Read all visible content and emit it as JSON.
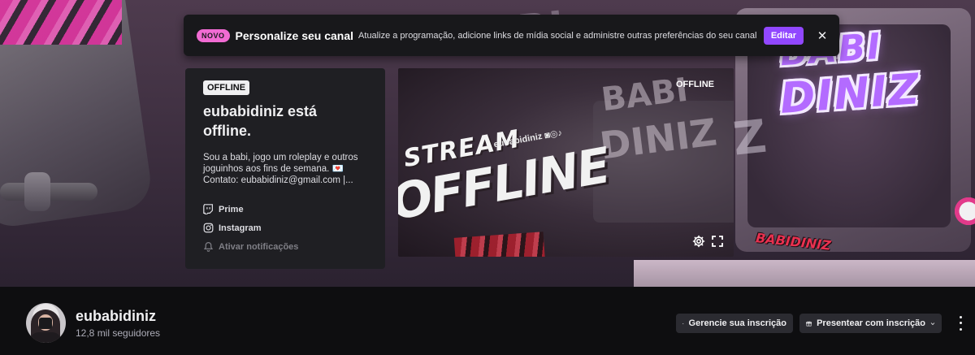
{
  "notification": {
    "badge": "NOVO",
    "title": "Personalize seu canal",
    "description": "Atualize a programação, adicione links de mídia social e administre outras preferências do seu canal",
    "edit_label": "Editar",
    "close_icon": "close-icon"
  },
  "offline_card": {
    "tag": "OFFLINE",
    "headline": "eubabidiniz está offline.",
    "bio_line1": "Sou a babi, jogo um roleplay e outros",
    "bio_line2": "joguinhos aos fins de semana. 💌",
    "bio_line3": "Contato: eubabidiniz@gmail.com |...",
    "links": [
      {
        "label": "Prime",
        "icon": "twitch-prime-icon"
      },
      {
        "label": "Instagram",
        "icon": "instagram-icon"
      },
      {
        "label": "Ativar notificações",
        "icon": "bell-icon"
      }
    ]
  },
  "video": {
    "status": "OFFLINE",
    "stream_word": "STREAM",
    "offline_word": "OFFLINE",
    "handle": "eubabidiniz ◙◎♪",
    "controls": [
      "settings-icon",
      "fullscreen-icon"
    ]
  },
  "banner": {
    "logo_line1": "BABI",
    "logo_line2": "DINIZ",
    "sticker": "BABIDINIZ"
  },
  "channel": {
    "name": "eubabidiniz",
    "followers": "12,8 mil seguidores"
  },
  "actions": {
    "manage_label": "Gerencie sua inscrição",
    "gift_label": "Presentear com inscrição"
  },
  "colors": {
    "accent": "#9147ff",
    "badge": "#f16bd3",
    "background": "#0e0e10"
  }
}
